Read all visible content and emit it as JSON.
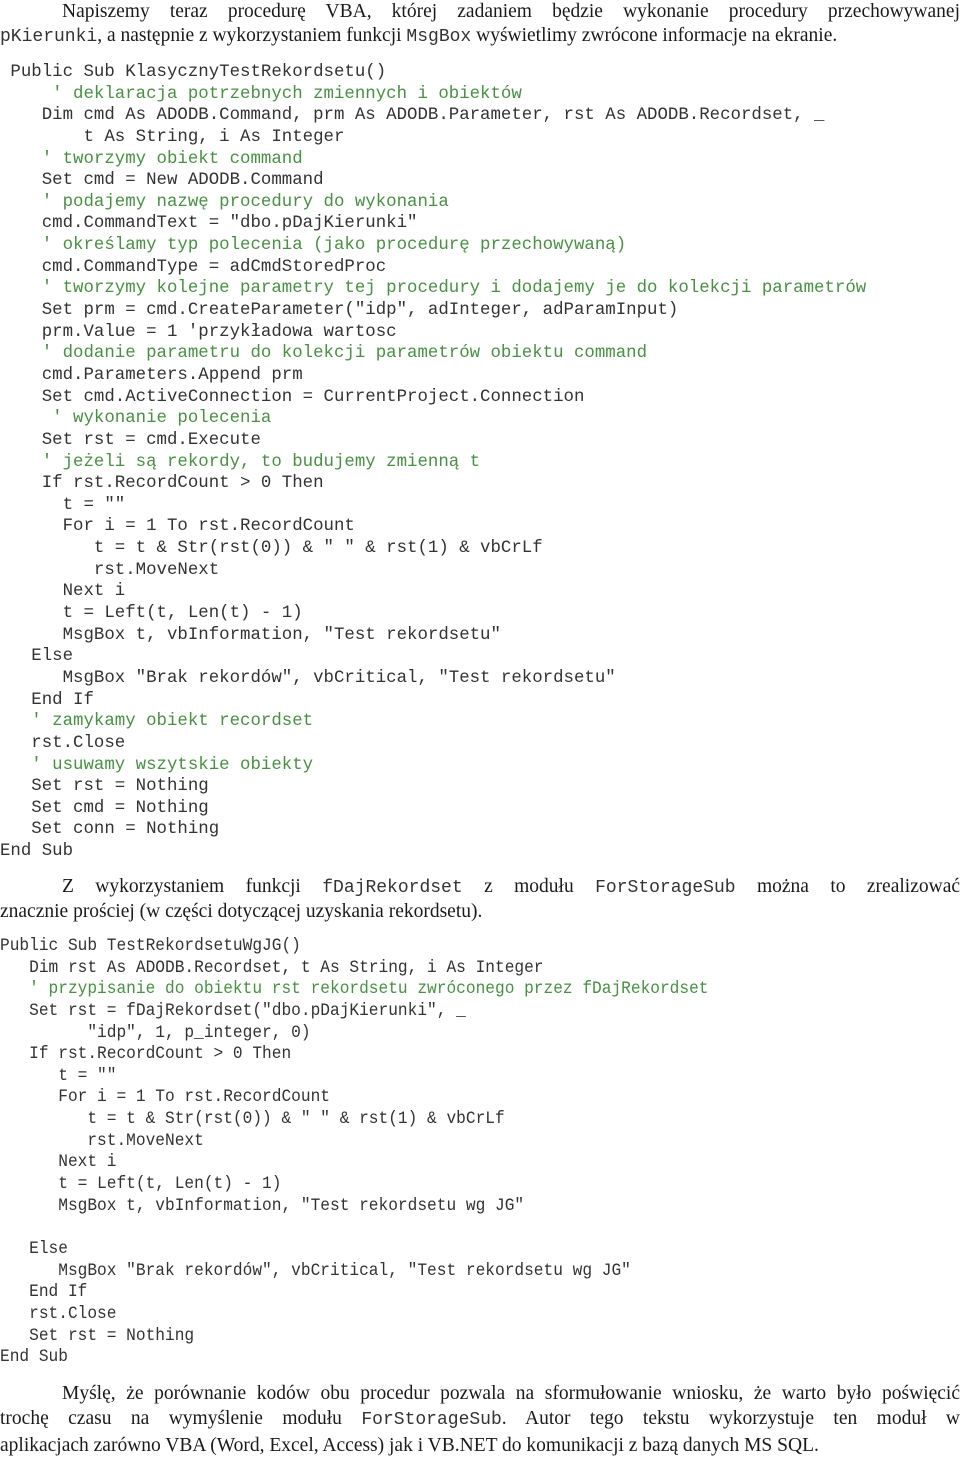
{
  "intro": {
    "line1": "Napiszemy teraz procedurę VBA, której zadaniem będzie wykonanie procedury przechowywanej",
    "line2_code": "pKierunki",
    "line2_text_a": ", a następnie z wykorzystaniem funkcji ",
    "line2_code_b": "MsgBox",
    "line2_text_b": " wyświetlimy zwrócone informacje na ekranie."
  },
  "code_block_1": {
    "lines": [
      {
        "indent": " ",
        "text": "Public Sub KlasycznyTestRekordsetu()",
        "type": "code"
      },
      {
        "indent": "     ",
        "text": "' deklaracja potrzebnych zmiennych i obiektów",
        "type": "comment"
      },
      {
        "indent": "    ",
        "text": "Dim cmd As ADODB.Command, prm As ADODB.Parameter, rst As ADODB.Recordset, _",
        "type": "code"
      },
      {
        "indent": "        ",
        "text": "t As String, i As Integer",
        "type": "code"
      },
      {
        "indent": "    ",
        "text": "' tworzymy obiekt command",
        "type": "comment"
      },
      {
        "indent": "    ",
        "text": "Set cmd = New ADODB.Command",
        "type": "code"
      },
      {
        "indent": "    ",
        "text": "' podajemy nazwę procedury do wykonania",
        "type": "comment"
      },
      {
        "indent": "    ",
        "text": "cmd.CommandText = \"dbo.pDajKierunki\"",
        "type": "code"
      },
      {
        "indent": "    ",
        "text": "' określamy typ polecenia (jako procedurę przechowywaną)",
        "type": "comment"
      },
      {
        "indent": "    ",
        "text": "cmd.CommandType = adCmdStoredProc",
        "type": "code"
      },
      {
        "indent": "    ",
        "text": "' tworzymy kolejne parametry tej procedury i dodajemy je do kolekcji parametrów",
        "type": "comment"
      },
      {
        "indent": "    ",
        "text": "Set prm = cmd.CreateParameter(\"idp\", adInteger, adParamInput)",
        "type": "code"
      },
      {
        "indent": "    ",
        "text": "prm.Value = 1 'przykładowa wartosc",
        "type": "code"
      },
      {
        "indent": "    ",
        "text": "' dodanie parametru do kolekcji parametrów obiektu command",
        "type": "comment"
      },
      {
        "indent": "    ",
        "text": "cmd.Parameters.Append prm",
        "type": "code"
      },
      {
        "indent": "    ",
        "text": "Set cmd.ActiveConnection = CurrentProject.Connection",
        "type": "code"
      },
      {
        "indent": "     ",
        "text": "' wykonanie polecenia",
        "type": "comment"
      },
      {
        "indent": "    ",
        "text": "Set rst = cmd.Execute",
        "type": "code"
      },
      {
        "indent": "    ",
        "text": "' jeżeli są rekordy, to budujemy zmienną t",
        "type": "comment"
      },
      {
        "indent": "    ",
        "text": "If rst.RecordCount > 0 Then",
        "type": "code"
      },
      {
        "indent": "      ",
        "text": "t = \"\"",
        "type": "code"
      },
      {
        "indent": "      ",
        "text": "For i = 1 To rst.RecordCount",
        "type": "code"
      },
      {
        "indent": "         ",
        "text": "t = t & Str(rst(0)) & \" \" & rst(1) & vbCrLf",
        "type": "code"
      },
      {
        "indent": "         ",
        "text": "rst.MoveNext",
        "type": "code"
      },
      {
        "indent": "      ",
        "text": "Next i",
        "type": "code"
      },
      {
        "indent": "      ",
        "text": "t = Left(t, Len(t) - 1)",
        "type": "code"
      },
      {
        "indent": "      ",
        "text": "MsgBox t, vbInformation, \"Test rekordsetu\"",
        "type": "code"
      },
      {
        "indent": "   ",
        "text": "Else",
        "type": "code"
      },
      {
        "indent": "      ",
        "text": "MsgBox \"Brak rekordów\", vbCritical, \"Test rekordsetu\"",
        "type": "code"
      },
      {
        "indent": "   ",
        "text": "End If",
        "type": "code"
      },
      {
        "indent": "   ",
        "text": "' zamykamy obiekt recordset",
        "type": "comment"
      },
      {
        "indent": "   ",
        "text": "rst.Close",
        "type": "code"
      },
      {
        "indent": "   ",
        "text": "' usuwamy wszytskie obiekty",
        "type": "comment"
      },
      {
        "indent": "   ",
        "text": "Set rst = Nothing",
        "type": "code"
      },
      {
        "indent": "   ",
        "text": "Set cmd = Nothing",
        "type": "code"
      },
      {
        "indent": "   ",
        "text": "Set conn = Nothing",
        "type": "code"
      },
      {
        "indent": "",
        "text": "End Sub",
        "type": "code"
      }
    ]
  },
  "middle": {
    "text_a": "Z wykorzystaniem funkcji ",
    "code_a": "fDajRekordset",
    "text_b": " z modułu ",
    "code_b": "ForStorageSub",
    "text_c": " można to zrealizować",
    "line2": "znacznie prościej (w części dotyczącej uzyskania rekordsetu)."
  },
  "code_block_2": {
    "lines": [
      {
        "indent": "",
        "text": "Public Sub TestRekordsetuWgJG()",
        "type": "code"
      },
      {
        "indent": "   ",
        "text": "Dim rst As ADODB.Recordset, t As String, i As Integer",
        "type": "code"
      },
      {
        "indent": "   ",
        "text": "' przypisanie do obiektu rst rekordsetu zwróconego przez fDajRekordset",
        "type": "comment"
      },
      {
        "indent": "   ",
        "text": "Set rst = fDajRekordset(\"dbo.pDajKierunki\", _",
        "type": "code"
      },
      {
        "indent": "         ",
        "text": "\"idp\", 1, p_integer, 0)",
        "type": "code"
      },
      {
        "indent": "   ",
        "text": "If rst.RecordCount > 0 Then",
        "type": "code"
      },
      {
        "indent": "      ",
        "text": "t = \"\"",
        "type": "code"
      },
      {
        "indent": "      ",
        "text": "For i = 1 To rst.RecordCount",
        "type": "code"
      },
      {
        "indent": "         ",
        "text": "t = t & Str(rst(0)) & \" \" & rst(1) & vbCrLf",
        "type": "code"
      },
      {
        "indent": "         ",
        "text": "rst.MoveNext",
        "type": "code"
      },
      {
        "indent": "      ",
        "text": "Next i",
        "type": "code"
      },
      {
        "indent": "      ",
        "text": "t = Left(t, Len(t) - 1)",
        "type": "code"
      },
      {
        "indent": "      ",
        "text": "MsgBox t, vbInformation, \"Test rekordsetu wg JG\"",
        "type": "code"
      },
      {
        "indent": "",
        "text": "",
        "type": "code"
      },
      {
        "indent": "   ",
        "text": "Else",
        "type": "code"
      },
      {
        "indent": "      ",
        "text": "MsgBox \"Brak rekordów\", vbCritical, \"Test rekordsetu wg JG\"",
        "type": "code"
      },
      {
        "indent": "   ",
        "text": "End If",
        "type": "code"
      },
      {
        "indent": "   ",
        "text": "rst.Close",
        "type": "code"
      },
      {
        "indent": "   ",
        "text": "Set rst = Nothing",
        "type": "code"
      },
      {
        "indent": "",
        "text": "End Sub",
        "type": "code"
      }
    ]
  },
  "conclusion": {
    "line1": "Myślę, że porównanie kodów obu procedur pozwala na sformułowanie wniosku, że warto było poświęcić",
    "line2_text_a": "trochę czasu na wymyślenie modułu ",
    "line2_code": "ForStorageSub",
    "line2_text_b": ". Autor tego tekstu wykorzystuje ten moduł w",
    "line3": "aplikacjach zarówno VBA (Word, Excel, Access) jak i VB.NET do komunikacji z bazą danych MS SQL."
  },
  "colors": {
    "text": "#1a1a1a",
    "code": "#333333",
    "comment": "#4a8f45"
  }
}
